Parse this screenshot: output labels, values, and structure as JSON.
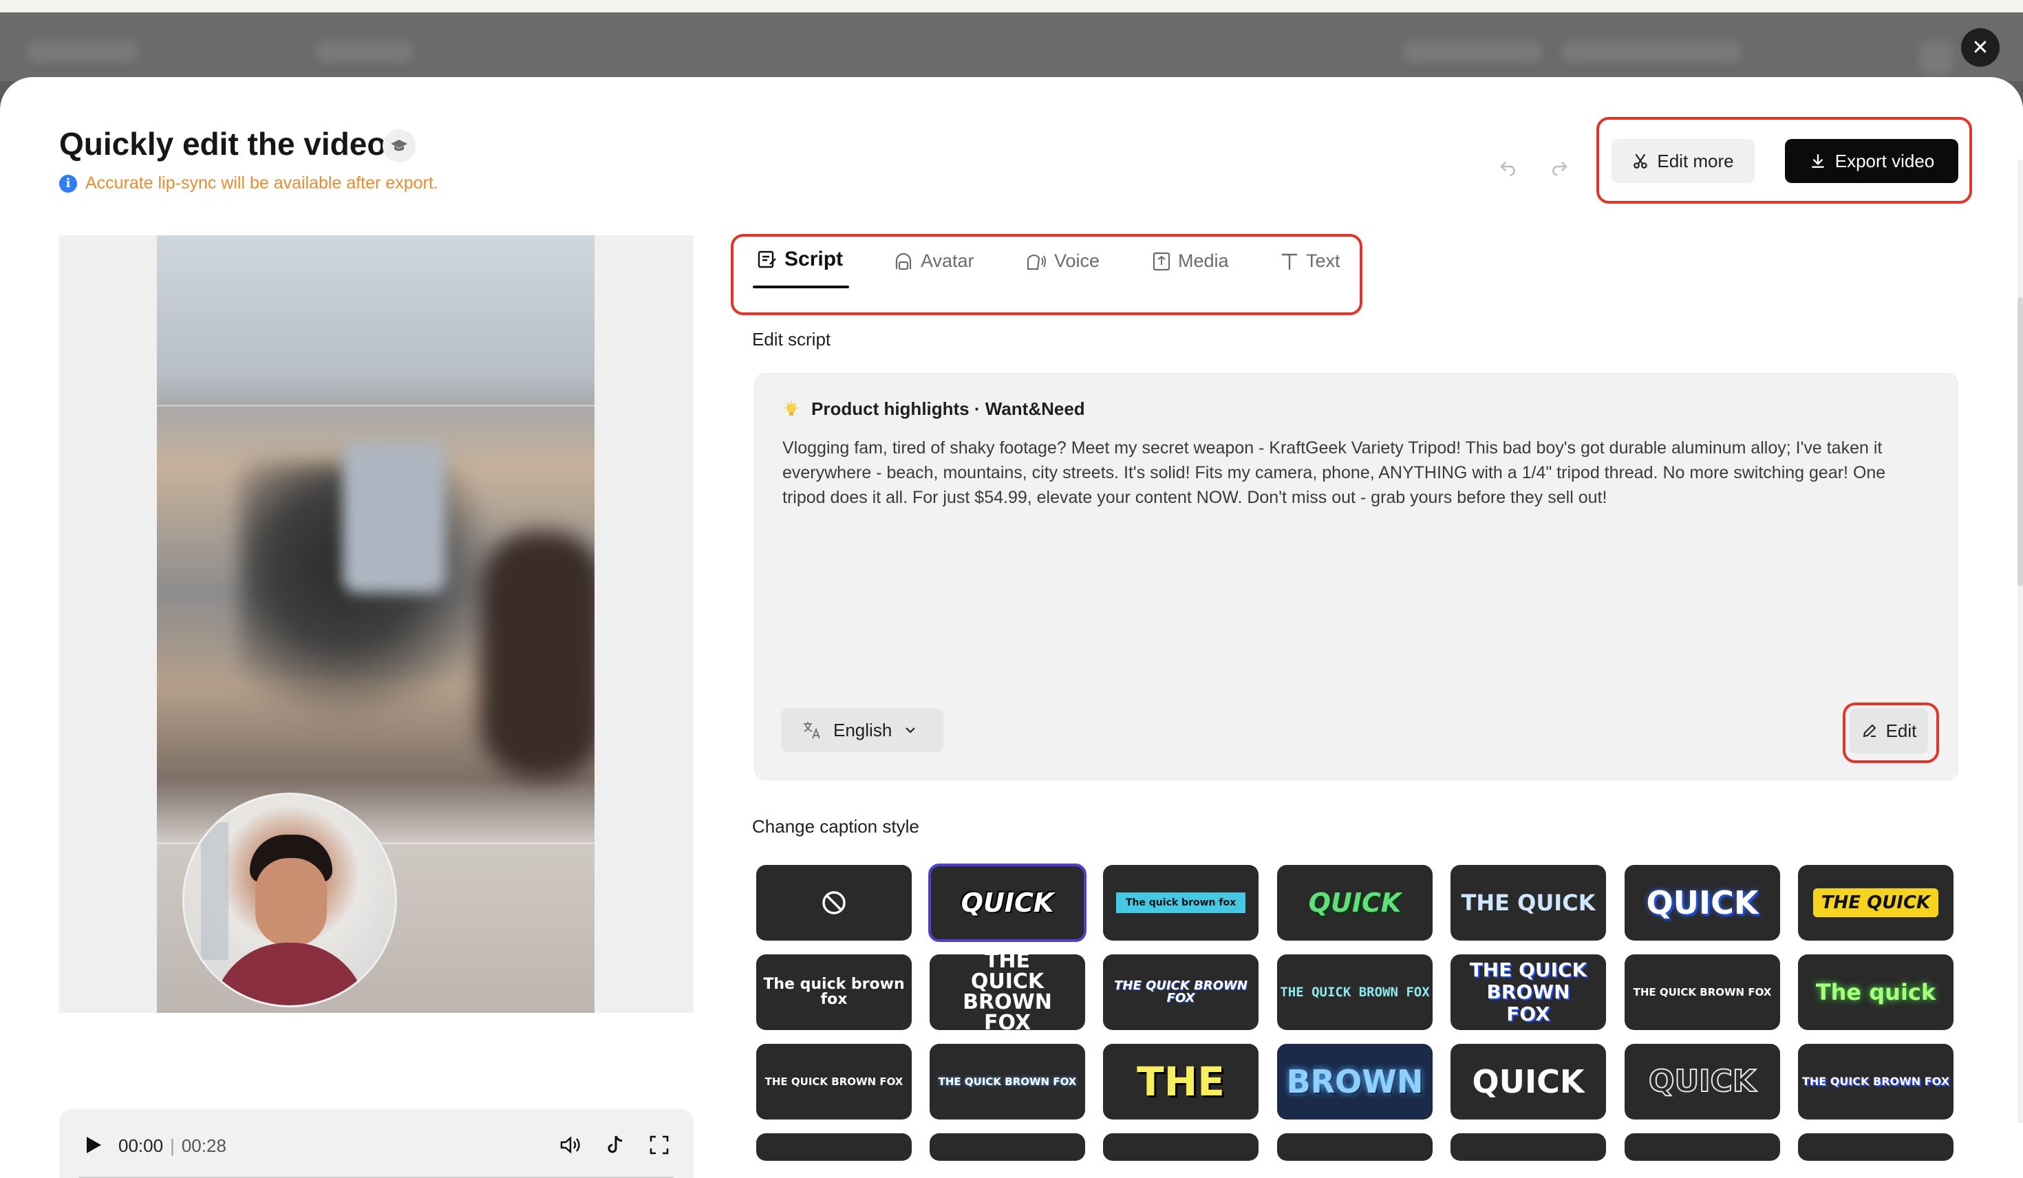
{
  "header": {
    "title": "Quickly edit the video",
    "notice": "Accurate lip-sync will be available after export.",
    "edit_more_label": "Edit more",
    "export_label": "Export video"
  },
  "player": {
    "current_time": "00:00",
    "separator": "|",
    "duration": "00:28",
    "progress": 0
  },
  "tabs": [
    {
      "label": "Script",
      "icon": "script-icon",
      "active": true
    },
    {
      "label": "Avatar",
      "icon": "avatar-icon",
      "active": false
    },
    {
      "label": "Voice",
      "icon": "voice-icon",
      "active": false
    },
    {
      "label": "Media",
      "icon": "media-icon",
      "active": false
    },
    {
      "label": "Text",
      "icon": "text-icon",
      "active": false
    }
  ],
  "script": {
    "section_label": "Edit script",
    "heading": "Product highlights · Want&Need",
    "body": "Vlogging fam, tired of shaky footage? Meet my secret weapon - KraftGeek Variety Tripod! This bad boy's got durable aluminum alloy; I've taken it everywhere - beach, mountains, city streets. It's solid! Fits my camera, phone, ANYTHING with a 1/4\" tripod thread. No more switching gear! One tripod does it all. For just $54.99, elevate your content NOW. Don't miss out - grab yours before they sell out!",
    "language": "English",
    "edit_label": "Edit"
  },
  "captions": {
    "section_label": "Change caption style",
    "styles": [
      [
        "",
        "QUICK",
        "The quick brown fox",
        "QUICK",
        "THE QUICK",
        "QUICK",
        "THE QUICK"
      ],
      [
        "The quick brown fox",
        "THE QUICK BROWN FOX",
        "THE QUICK BROWN FOX",
        "THE QUICK BROWN FOX",
        "THE QUICK BROWN FOX",
        "THE QUICK BROWN FOX",
        "The quick"
      ],
      [
        "THE QUICK BROWN FOX",
        "THE QUICK BROWN FOX",
        "THE",
        "BROWN",
        "QUICK",
        "QUICK",
        "THE QUICK BROWN FOX"
      ]
    ]
  },
  "colors": {
    "accent_outline": "#e3342a",
    "notice": "#e98b2e",
    "info": "#2f7cf6",
    "selected_style": "#4b3fd6",
    "primary_button": "#0b0b0b"
  }
}
